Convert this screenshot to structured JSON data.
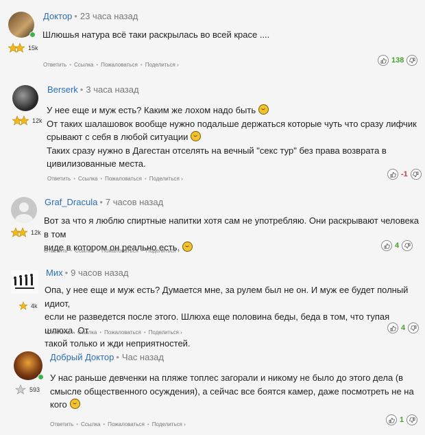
{
  "comments": [
    {
      "author": "Доктор",
      "time": "23 часа назад",
      "rank": "15k",
      "text": [
        "Шлюшья натура всё таки раскрылась во всей красе ...."
      ],
      "score": "138",
      "online": true
    },
    {
      "author": "Berserk",
      "time": "3 часа назад",
      "rank": "12k",
      "text": [
        "У нее еще и муж есть? Каким же лохом надо быть",
        "От таких шалашовок вообще нужно подальше держаться которые чуть что сразу лифчик",
        "срывают с себя в любой ситуации",
        "Таких сразу нужно в Дагестан отселять на вечный \"секс тур\" без права возврата в",
        "цивилизованные места."
      ],
      "score": "-1",
      "online": false
    },
    {
      "author": "Graf_Dracula",
      "time": "7 часов назад",
      "rank": "12k",
      "text": [
        "Вот за что я люблю спиртные напитки хотя сам не употребляю. Они раскрывают человека в том",
        "виде в котором он реально есть."
      ],
      "score": "4",
      "online": false
    },
    {
      "author": "Мих",
      "time": "9 часов назад",
      "rank": "4k",
      "text": [
        "Опа, у нее еще и муж есть? Думается мне, за рулем был не он. И муж ее будет полный идиот,",
        "если не разведется после этого. Шлюха еще половина беды, беда в том, что тупая шлюха. От",
        "такой только и жди неприятностей."
      ],
      "score": "4",
      "online": false
    },
    {
      "author": "Добрый Доктор",
      "time": "Час назад",
      "rank": "593",
      "text": [
        "У нас раньше девченки на пляже топлес загорали и никому не было до этого дела (в",
        "смысле общественного осуждения), а сейчас все боятся камер, даже посмотреть не на",
        "кого"
      ],
      "score": "1",
      "online": true
    }
  ],
  "actions": {
    "reply": "Ответить",
    "link": "Ссылка",
    "report": "Пожаловаться",
    "share": "Поделиться ›"
  },
  "colors": {
    "author": "#2a6fb7",
    "positive": "#4aa02c",
    "negative": "#d0393b",
    "online": "#3bb54a"
  },
  "icons": {
    "rank": "star-icon",
    "upvote": "thumbs-up-icon",
    "downvote": "thumbs-down-icon",
    "emoji": "smiley-icon"
  }
}
